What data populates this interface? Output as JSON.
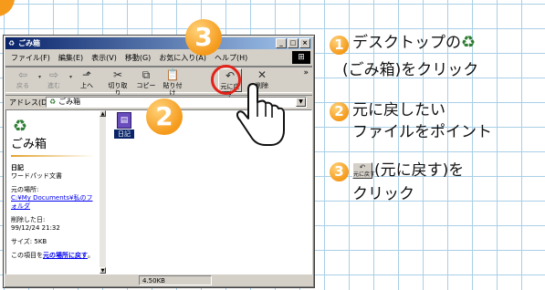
{
  "window": {
    "title": "ごみ箱",
    "minimize": "_",
    "maximize": "□",
    "close": "×",
    "menus": [
      "ファイル(F)",
      "編集(E)",
      "表示(V)",
      "移動(G)",
      "お気に入り(A)",
      "ヘルプ(H)"
    ],
    "toolbar": {
      "back": "戻る",
      "forward": "進む",
      "up": "上へ",
      "cut": "切り取り",
      "copy": "コピー",
      "paste": "貼り付け",
      "restore": "元に戻す",
      "delete": "削除",
      "more": "»"
    },
    "address": {
      "label": "アドレス(D)",
      "value": "ごみ箱"
    },
    "left_pane": {
      "title": "ごみ箱",
      "item_name": "日記",
      "item_type": "ワードパッド文書",
      "original_location_label": "元の場所:",
      "original_location_link": "C:¥My Documents¥私のフォルダ",
      "deleted_date_label": "削除した日:",
      "deleted_date": "99/12/24 21:32",
      "size": "サイズ: 5KB",
      "restore_text_prefix": "この項目を",
      "restore_text_link": "元の場所に戻す",
      "restore_text_suffix": "。"
    },
    "file_label": "日記",
    "status": "4.50KB"
  },
  "callouts": {
    "step2": "2",
    "step3": "3"
  },
  "instructions": [
    {
      "num": "1",
      "line1": "デスクトップの",
      "line2": "(ごみ箱)をクリック"
    },
    {
      "num": "2",
      "line1": "元に戻したい",
      "line2": "ファイルをポイント"
    },
    {
      "num": "3",
      "line1": "(元に戻す)を",
      "line2": "クリック"
    }
  ]
}
